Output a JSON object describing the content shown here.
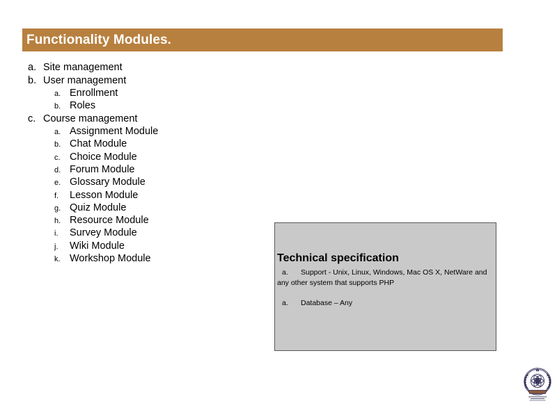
{
  "slide": {
    "title": "Functionality Modules.",
    "title_bar_color": "#b8803f",
    "title_text_color": "#ffffff",
    "background_color": "#ffffff"
  },
  "outline": {
    "items": [
      {
        "level": 1,
        "marker": "a.",
        "label": "Site management"
      },
      {
        "level": 1,
        "marker": "b.",
        "label": "User management"
      },
      {
        "level": 2,
        "marker": "a.",
        "label": "Enrollment"
      },
      {
        "level": 2,
        "marker": "b.",
        "label": "Roles"
      },
      {
        "level": 1,
        "marker": "c.",
        "label": "Course management"
      },
      {
        "level": 2,
        "marker": "a.",
        "label": "Assignment Module"
      },
      {
        "level": 2,
        "marker": "b.",
        "label": "Chat Module"
      },
      {
        "level": 2,
        "marker": "c.",
        "label": "Choice Module"
      },
      {
        "level": 2,
        "marker": "d.",
        "label": "Forum Module"
      },
      {
        "level": 2,
        "marker": "e.",
        "label": "Glossary Module"
      },
      {
        "level": 2,
        "marker": "f.",
        "label": "Lesson Module"
      },
      {
        "level": 2,
        "marker": "g.",
        "label": "Quiz Module"
      },
      {
        "level": 2,
        "marker": "h.",
        "label": "Resource Module"
      },
      {
        "level": 2,
        "marker": "i.",
        "label": "Survey Module"
      },
      {
        "level": 2,
        "marker": "j.",
        "label": "Wiki Module"
      },
      {
        "level": 2,
        "marker": "k.",
        "label": "Workshop Module"
      }
    ]
  },
  "spec_box": {
    "heading": "Technical specification",
    "fill_color": "#c9c9c9",
    "border_color": "#595959",
    "items": [
      {
        "marker": "a.",
        "label": "Support - Unix, Linux, Windows, Mac OS X, NetWare and any other system that supports PHP"
      },
      {
        "marker": "a.",
        "label": "Database – Any"
      }
    ]
  },
  "seal": {
    "icon": "institution-seal-icon",
    "color": "#2e2a55"
  }
}
